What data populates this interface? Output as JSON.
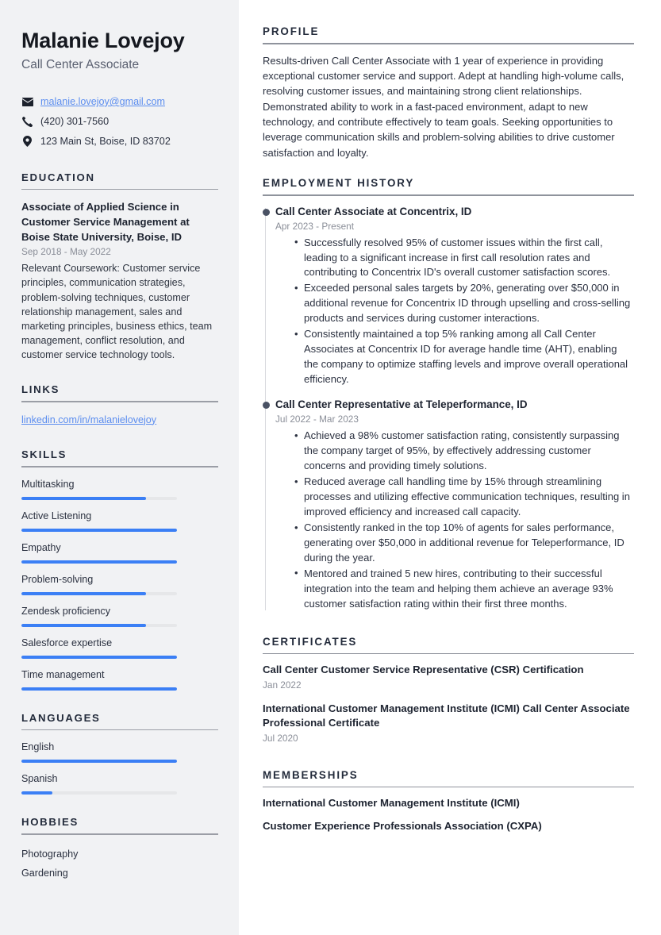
{
  "theme": {
    "sidebar_bg": "#f1f2f4",
    "accent_blue": "#3b7ff5",
    "link_blue": "#5b8def",
    "heading_color": "#232b3b",
    "muted_text": "#8a8e98"
  },
  "header": {
    "name": "Malanie Lovejoy",
    "job_title": "Call Center Associate"
  },
  "contact": {
    "email": "malanie.lovejoy@gmail.com",
    "phone": "(420) 301-7560",
    "address": "123 Main St, Boise, ID 83702",
    "email_icon": "envelope-icon",
    "phone_icon": "phone-icon",
    "address_icon": "location-pin-icon"
  },
  "sidebar": {
    "education": {
      "heading": "EDUCATION",
      "degree": "Associate of Applied Science in Customer Service Management at Boise State University, Boise, ID",
      "date": "Sep 2018 - May 2022",
      "description": "Relevant Coursework: Customer service principles, communication strategies, problem-solving techniques, customer relationship management, sales and marketing principles, business ethics, team management, conflict resolution, and customer service technology tools."
    },
    "links": {
      "heading": "LINKS",
      "items": [
        {
          "label": "linkedin.com/in/malanielovejoy"
        }
      ]
    },
    "skills": {
      "heading": "SKILLS",
      "items": [
        {
          "label": "Multitasking",
          "level": 80
        },
        {
          "label": "Active Listening",
          "level": 100
        },
        {
          "label": "Empathy",
          "level": 100
        },
        {
          "label": "Problem-solving",
          "level": 80
        },
        {
          "label": "Zendesk proficiency",
          "level": 80
        },
        {
          "label": "Salesforce expertise",
          "level": 100
        },
        {
          "label": "Time management",
          "level": 100
        }
      ]
    },
    "languages": {
      "heading": "LANGUAGES",
      "items": [
        {
          "label": "English",
          "level": 100
        },
        {
          "label": "Spanish",
          "level": 20
        }
      ]
    },
    "hobbies": {
      "heading": "HOBBIES",
      "items": [
        {
          "label": "Photography"
        },
        {
          "label": "Gardening"
        }
      ]
    }
  },
  "main": {
    "profile": {
      "heading": "PROFILE",
      "text": "Results-driven Call Center Associate with 1 year of experience in providing exceptional customer service and support. Adept at handling high-volume calls, resolving customer issues, and maintaining strong client relationships. Demonstrated ability to work in a fast-paced environment, adapt to new technology, and contribute effectively to team goals. Seeking opportunities to leverage communication skills and problem-solving abilities to drive customer satisfaction and loyalty."
    },
    "employment": {
      "heading": "EMPLOYMENT HISTORY",
      "jobs": [
        {
          "title": "Call Center Associate at Concentrix, ID",
          "date": "Apr 2023 - Present",
          "bullets": [
            "Successfully resolved 95% of customer issues within the first call, leading to a significant increase in first call resolution rates and contributing to Concentrix ID's overall customer satisfaction scores.",
            "Exceeded personal sales targets by 20%, generating over $50,000 in additional revenue for Concentrix ID through upselling and cross-selling products and services during customer interactions.",
            "Consistently maintained a top 5% ranking among all Call Center Associates at Concentrix ID for average handle time (AHT), enabling the company to optimize staffing levels and improve overall operational efficiency."
          ]
        },
        {
          "title": "Call Center Representative at Teleperformance, ID",
          "date": "Jul 2022 - Mar 2023",
          "bullets": [
            "Achieved a 98% customer satisfaction rating, consistently surpassing the company target of 95%, by effectively addressing customer concerns and providing timely solutions.",
            "Reduced average call handling time by 15% through streamlining processes and utilizing effective communication techniques, resulting in improved efficiency and increased call capacity.",
            "Consistently ranked in the top 10% of agents for sales performance, generating over $50,000 in additional revenue for Teleperformance, ID during the year.",
            "Mentored and trained 5 new hires, contributing to their successful integration into the team and helping them achieve an average 93% customer satisfaction rating within their first three months."
          ]
        }
      ]
    },
    "certificates": {
      "heading": "CERTIFICATES",
      "items": [
        {
          "title": "Call Center Customer Service Representative (CSR) Certification",
          "date": "Jan 2022"
        },
        {
          "title": "International Customer Management Institute (ICMI) Call Center Associate Professional Certificate",
          "date": "Jul 2020"
        }
      ]
    },
    "memberships": {
      "heading": "MEMBERSHIPS",
      "items": [
        {
          "title": "International Customer Management Institute (ICMI)"
        },
        {
          "title": "Customer Experience Professionals Association (CXPA)"
        }
      ]
    }
  }
}
